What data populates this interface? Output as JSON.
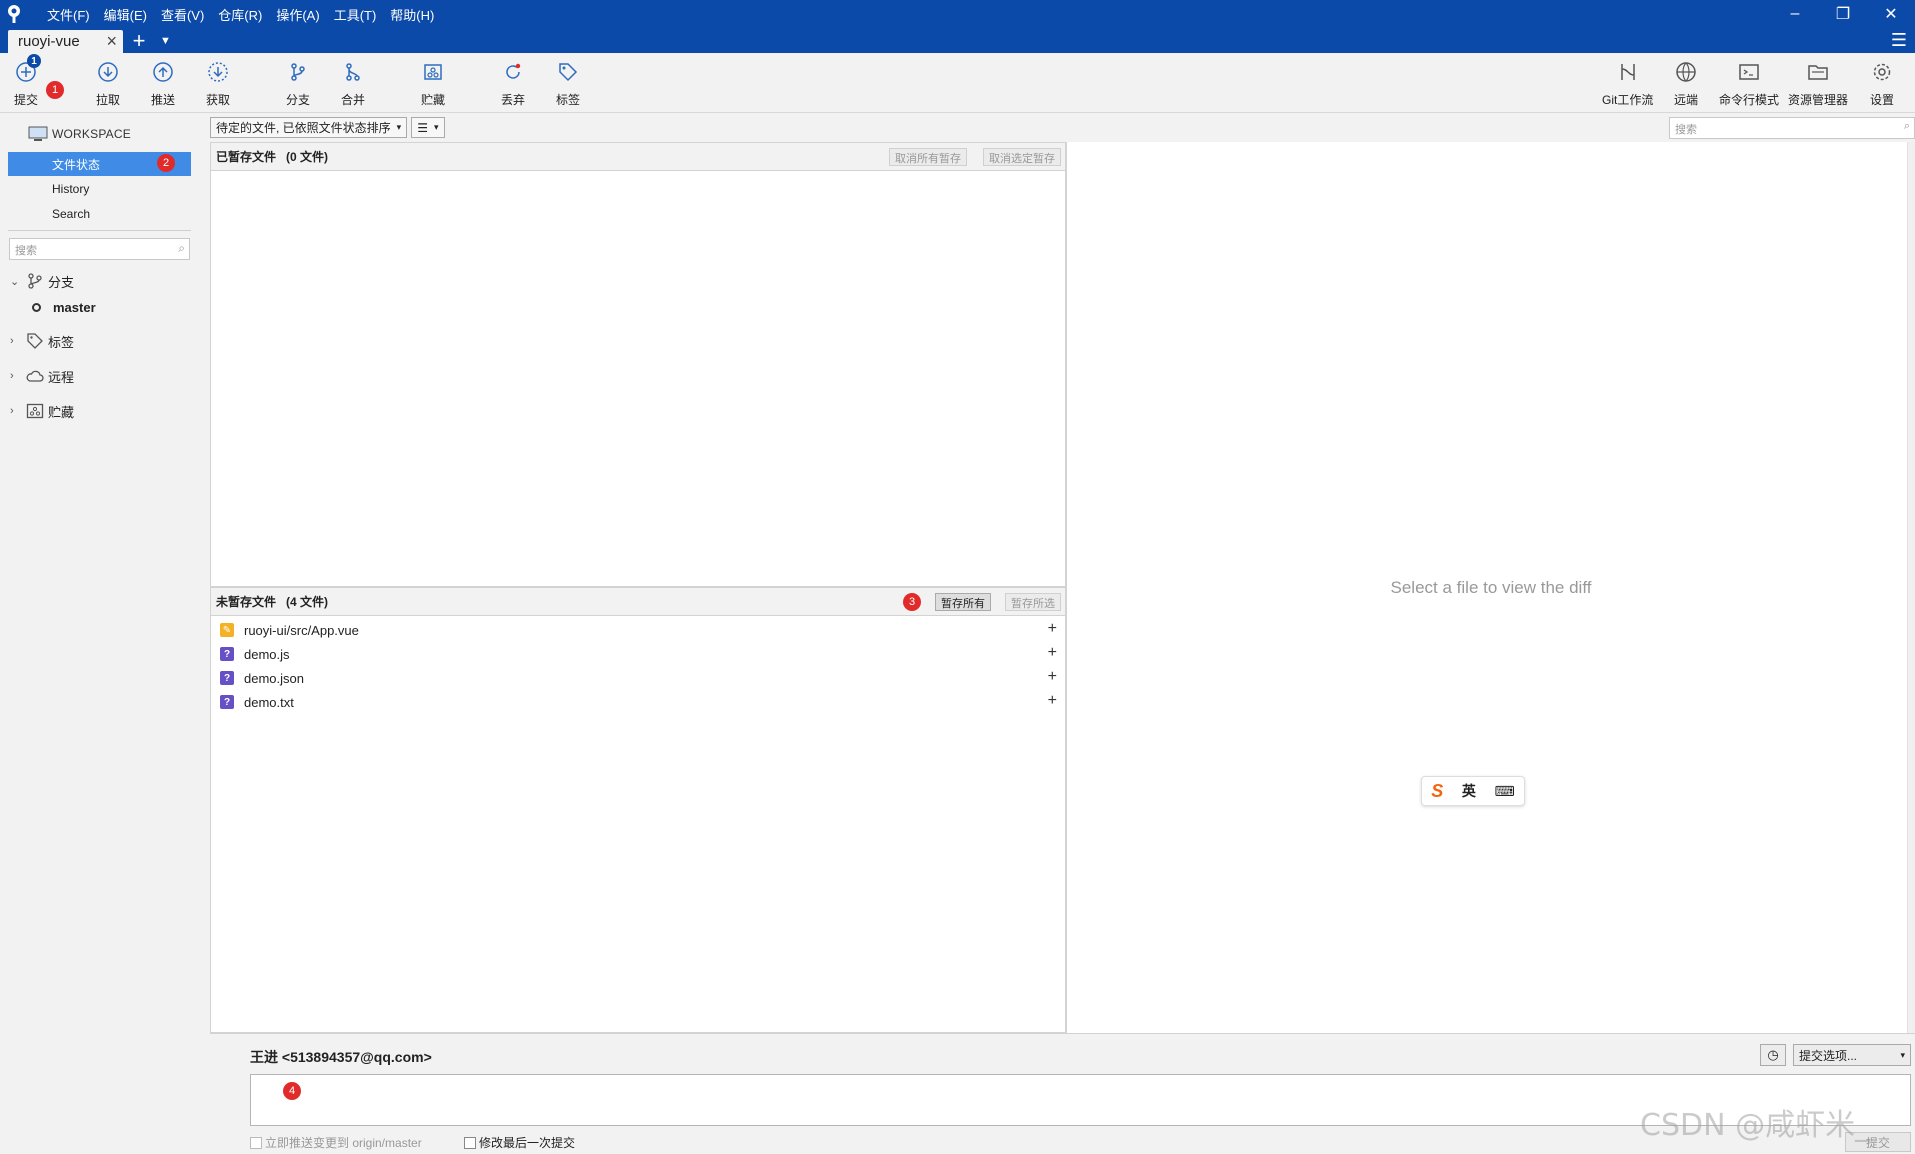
{
  "menubar": [
    "文件(F)",
    "编辑(E)",
    "查看(V)",
    "仓库(R)",
    "操作(A)",
    "工具(T)",
    "帮助(H)"
  ],
  "tab": {
    "repo_name": "ruoyi-vue"
  },
  "toolbar": {
    "commit": "提交",
    "commit_count": "1",
    "pull": "拉取",
    "push": "推送",
    "fetch": "获取",
    "branch": "分支",
    "merge": "合并",
    "stash": "贮藏",
    "discard": "丢弃",
    "tag": "标签",
    "git_flow": "Git工作流",
    "remote": "远端",
    "terminal": "命令行模式",
    "explorer": "资源管理器",
    "settings": "设置"
  },
  "annotations": [
    "1",
    "2",
    "3",
    "4"
  ],
  "sidebar": {
    "workspace": "WORKSPACE",
    "items": [
      "文件状态",
      "History",
      "Search"
    ],
    "search_placeholder": "搜索",
    "branches": "分支",
    "current_branch": "master",
    "tags": "标签",
    "remotes": "远程",
    "stashes": "贮藏"
  },
  "filter": {
    "sort": "待定的文件, 已依照文件状态排序",
    "view": "☰"
  },
  "right_search_placeholder": "搜索",
  "staged": {
    "title": "已暂存文件",
    "count": "(0 文件)",
    "unstage_all": "取消所有暂存",
    "unstage_selected": "取消选定暂存"
  },
  "unstaged": {
    "title": "未暂存文件",
    "count": "(4 文件)",
    "stage_all": "暂存所有",
    "stage_selected": "暂存所选",
    "files": [
      {
        "name": "ruoyi-ui/src/App.vue",
        "status": "modified"
      },
      {
        "name": "demo.js",
        "status": "untracked"
      },
      {
        "name": "demo.json",
        "status": "untracked"
      },
      {
        "name": "demo.txt",
        "status": "untracked"
      }
    ]
  },
  "diff": {
    "placeholder": "Select a file to view the diff"
  },
  "ime": {
    "mode": "英"
  },
  "commit": {
    "author": "王进 <513894357@qq.com>",
    "options": "提交选项...",
    "push_immediately": "立即推送变更到 origin/master",
    "amend": "修改最后一次提交",
    "commit_button": "提交"
  },
  "watermark": "CSDN @咸虾米_",
  "colors": {
    "titlebar": "#0b4aa9",
    "selection": "#3f8be5",
    "badge_red": "#e12b2b"
  }
}
